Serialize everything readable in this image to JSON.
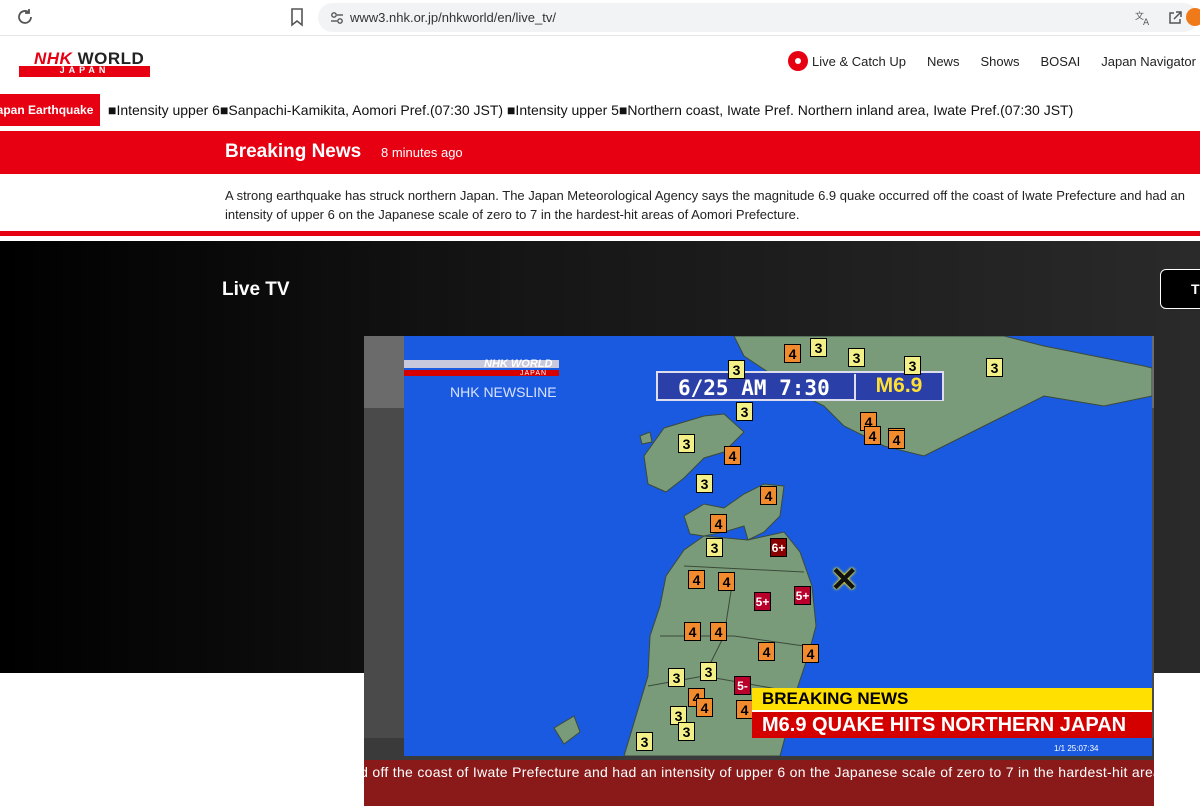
{
  "browser": {
    "url": "www3.nhk.or.jp/nhkworld/en/live_tv/"
  },
  "header": {
    "logo_main": "WORLD",
    "logo_nhk": "NHK",
    "logo_sub": "JAPAN",
    "nav": [
      "Live & Catch Up",
      "News",
      "Shows",
      "BOSAI",
      "Japan Navigator"
    ]
  },
  "ticker": {
    "label": "Japan Earthquake",
    "text": "■Intensity upper 6■Sanpachi-Kamikita, Aomori Pref.(07:30 JST) ■Intensity upper 5■Northern coast, Iwate Pref. Northern inland area, Iwate Pref.(07:30 JST)"
  },
  "breaking": {
    "title": "Breaking News",
    "time": "8 minutes ago",
    "body": "A strong earthquake has struck northern Japan. The Japan Meteorological Agency says the magnitude 6.9 quake occurred off the coast of Iwate Prefecture and had an intensity of upper 6 on the Japanese scale of zero to 7 in the hardest-hit areas of Aomori Prefecture."
  },
  "live": {
    "title": "Live TV",
    "tab_label": "T"
  },
  "broadcast": {
    "logo_nhk": "NHK WORLD",
    "logo_sub": "JAPAN",
    "program": "NHK NEWSLINE",
    "datetime": "6/25  AM  7:30",
    "magnitude": "M6.9",
    "banner_top": "BREAKING NEWS",
    "banner_main": "M6.9 QUAKE HITS NORTHERN JAPAN",
    "clock": "1/1     25:07:34",
    "epicenter_mark": "✕",
    "caption": "ed off the coast of Iwate Prefecture and had an intensity of upper 6 on the Japanese scale of zero to 7 in the hardest-hit areas of Aomori Prefecture."
  },
  "intensity_labels": {
    "i3": "3",
    "i4": "4",
    "i5p": "5+",
    "i6p": "6+",
    "i5m": "5-"
  },
  "colors": {
    "brand_red": "#e60012",
    "map_sea": "#1a5ae0",
    "map_land": "#7a9b7a",
    "banner_yellow": "#ffe000",
    "banner_red": "#d40000"
  }
}
